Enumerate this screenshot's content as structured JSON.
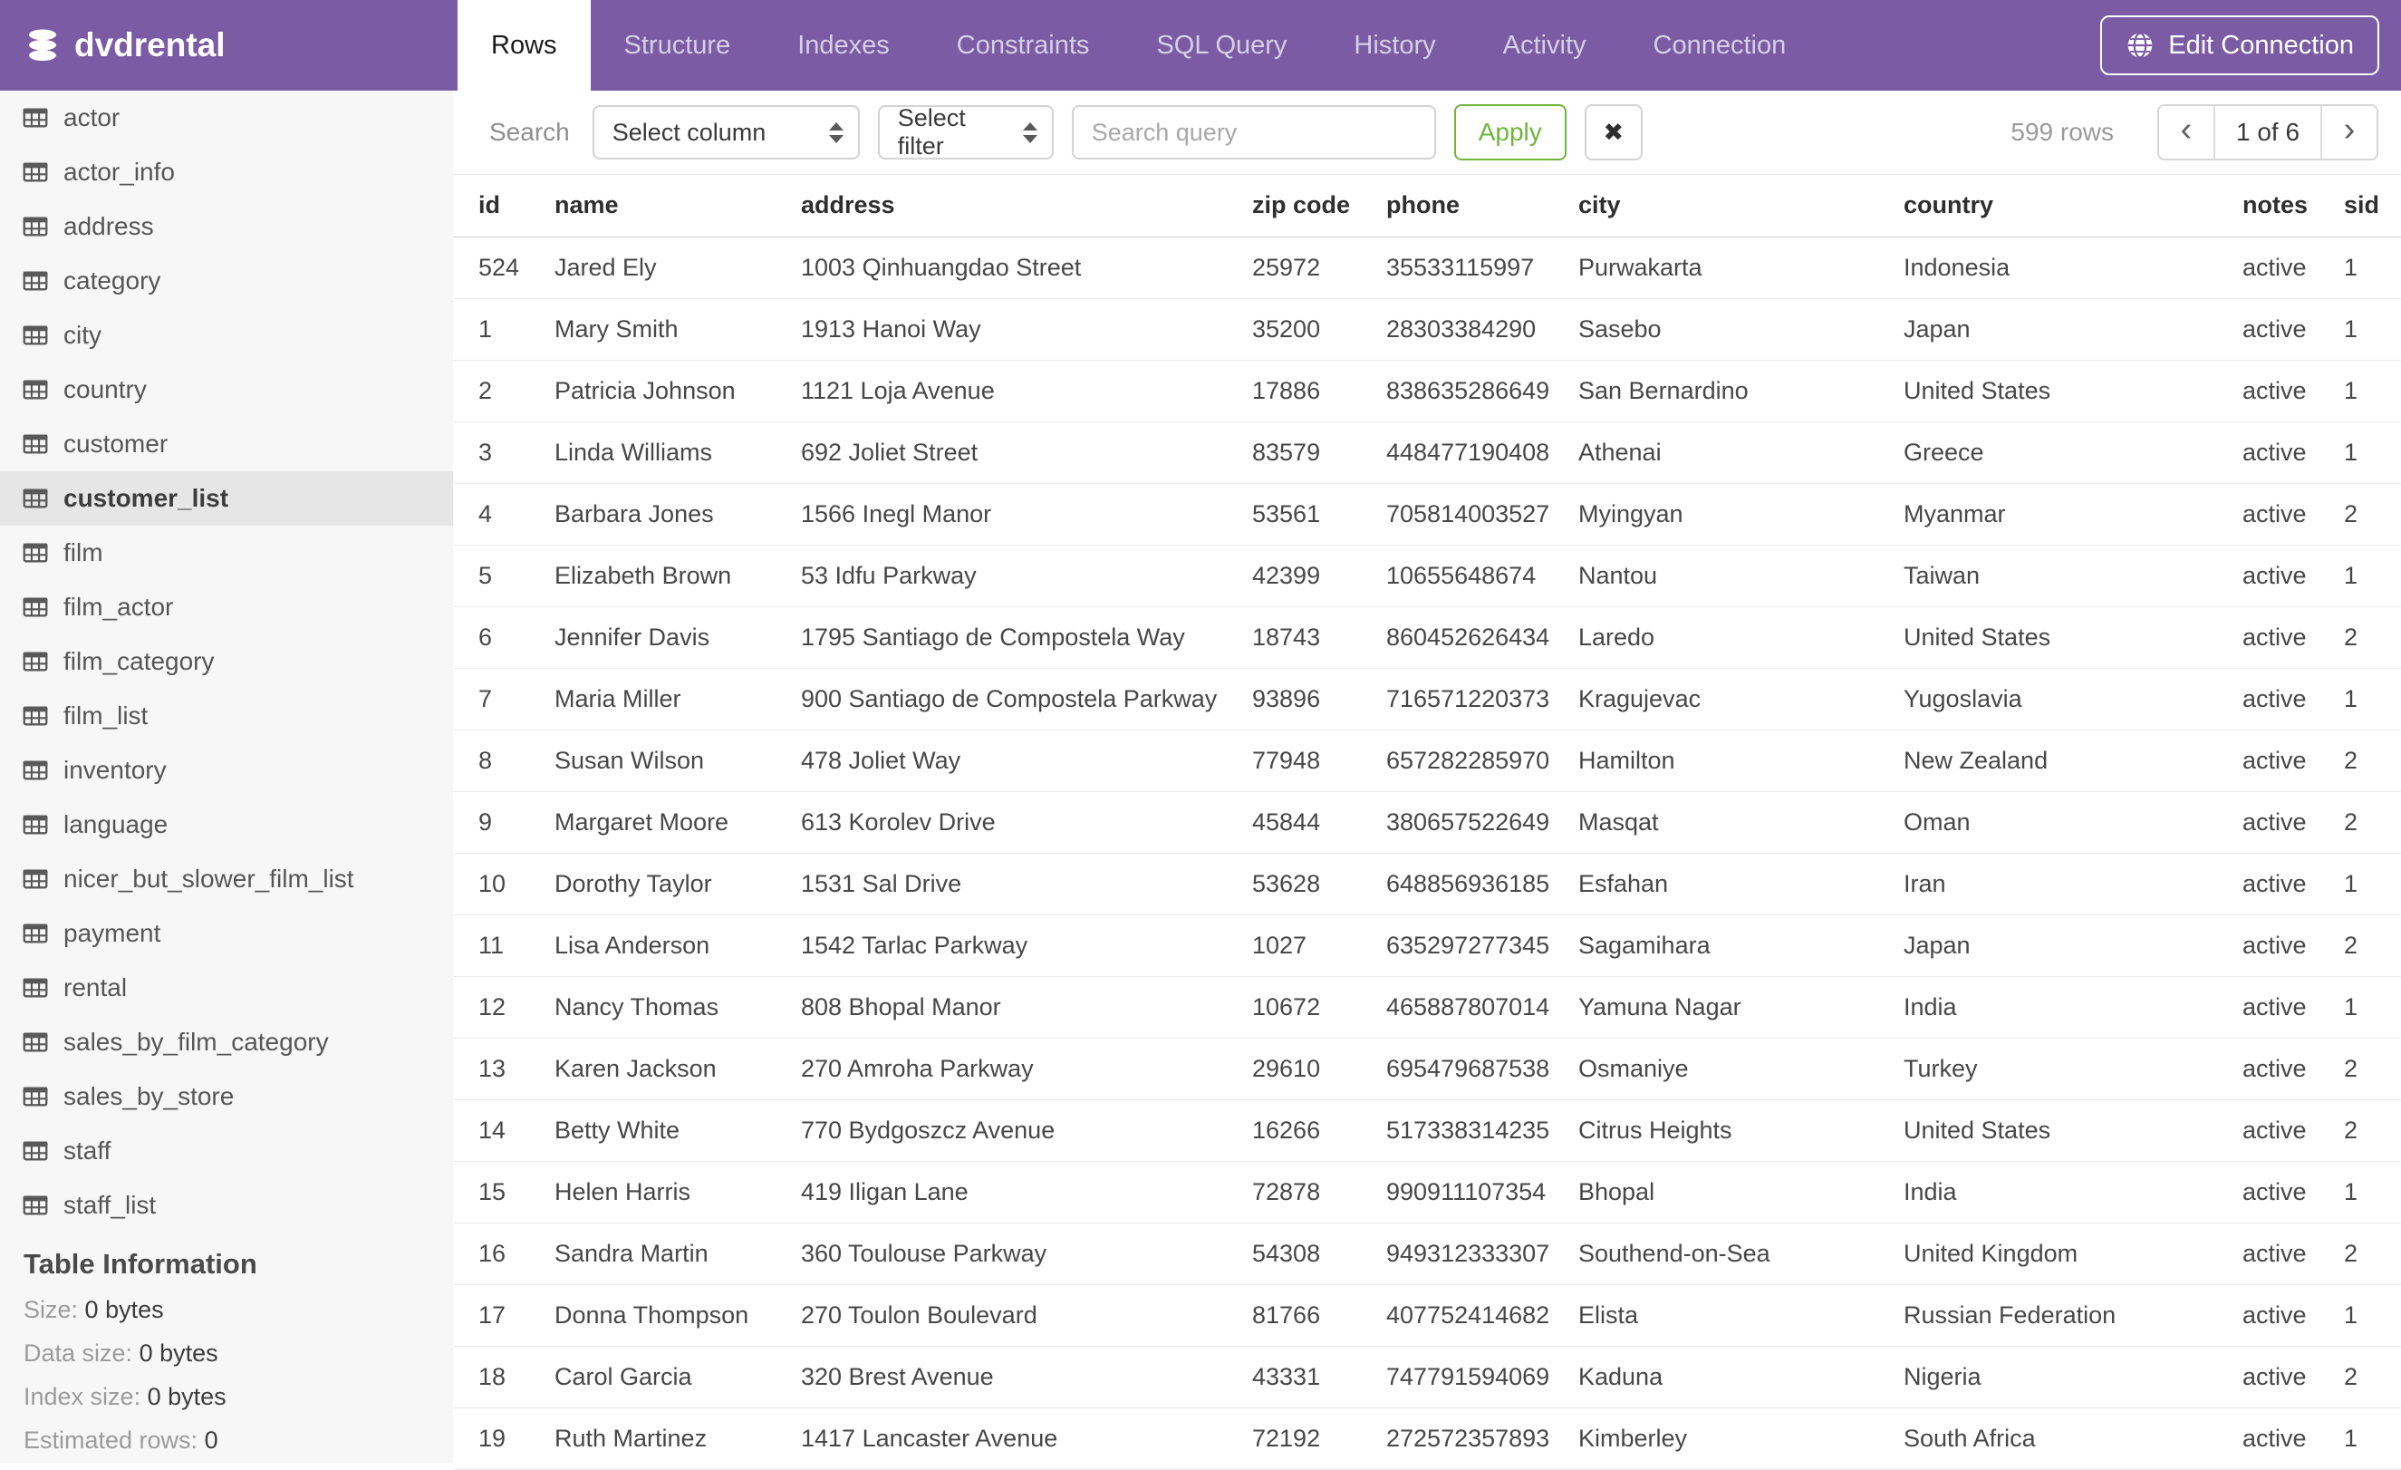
{
  "header": {
    "database_name": "dvdrental",
    "tabs": [
      {
        "label": "Rows",
        "active": true
      },
      {
        "label": "Structure",
        "active": false
      },
      {
        "label": "Indexes",
        "active": false
      },
      {
        "label": "Constraints",
        "active": false
      },
      {
        "label": "SQL Query",
        "active": false
      },
      {
        "label": "History",
        "active": false
      },
      {
        "label": "Activity",
        "active": false
      },
      {
        "label": "Connection",
        "active": false
      }
    ],
    "edit_connection_label": "Edit Connection"
  },
  "sidebar": {
    "tables": [
      "actor",
      "actor_info",
      "address",
      "category",
      "city",
      "country",
      "customer",
      "customer_list",
      "film",
      "film_actor",
      "film_category",
      "film_list",
      "inventory",
      "language",
      "nicer_but_slower_film_list",
      "payment",
      "rental",
      "sales_by_film_category",
      "sales_by_store",
      "staff",
      "staff_list"
    ],
    "selected_table": "customer_list",
    "info": {
      "heading": "Table Information",
      "rows": [
        {
          "label": "Size:",
          "value": "0 bytes"
        },
        {
          "label": "Data size:",
          "value": "0 bytes"
        },
        {
          "label": "Index size:",
          "value": "0 bytes"
        },
        {
          "label": "Estimated rows:",
          "value": "0"
        }
      ]
    }
  },
  "filter_bar": {
    "search_label": "Search",
    "column_select_value": "Select column",
    "filter_select_value": "Select filter",
    "query_placeholder": "Search query",
    "query_value": "",
    "apply_label": "Apply",
    "clear_icon": "✖",
    "rows_count": "599 rows",
    "pagination": {
      "prev": "‹",
      "current": "1 of 6",
      "next": "›"
    }
  },
  "table": {
    "columns": [
      "id",
      "name",
      "address",
      "zip code",
      "phone",
      "city",
      "country",
      "notes",
      "sid"
    ],
    "rows": [
      [
        "524",
        "Jared Ely",
        "1003 Qinhuangdao Street",
        "25972",
        "35533115997",
        "Purwakarta",
        "Indonesia",
        "active",
        "1"
      ],
      [
        "1",
        "Mary Smith",
        "1913 Hanoi Way",
        "35200",
        "28303384290",
        "Sasebo",
        "Japan",
        "active",
        "1"
      ],
      [
        "2",
        "Patricia Johnson",
        "1121 Loja Avenue",
        "17886",
        "838635286649",
        "San Bernardino",
        "United States",
        "active",
        "1"
      ],
      [
        "3",
        "Linda Williams",
        "692 Joliet Street",
        "83579",
        "448477190408",
        "Athenai",
        "Greece",
        "active",
        "1"
      ],
      [
        "4",
        "Barbara Jones",
        "1566 Inegl Manor",
        "53561",
        "705814003527",
        "Myingyan",
        "Myanmar",
        "active",
        "2"
      ],
      [
        "5",
        "Elizabeth Brown",
        "53 Idfu Parkway",
        "42399",
        "10655648674",
        "Nantou",
        "Taiwan",
        "active",
        "1"
      ],
      [
        "6",
        "Jennifer Davis",
        "1795 Santiago de Compostela Way",
        "18743",
        "860452626434",
        "Laredo",
        "United States",
        "active",
        "2"
      ],
      [
        "7",
        "Maria Miller",
        "900 Santiago de Compostela Parkway",
        "93896",
        "716571220373",
        "Kragujevac",
        "Yugoslavia",
        "active",
        "1"
      ],
      [
        "8",
        "Susan Wilson",
        "478 Joliet Way",
        "77948",
        "657282285970",
        "Hamilton",
        "New Zealand",
        "active",
        "2"
      ],
      [
        "9",
        "Margaret Moore",
        "613 Korolev Drive",
        "45844",
        "380657522649",
        "Masqat",
        "Oman",
        "active",
        "2"
      ],
      [
        "10",
        "Dorothy Taylor",
        "1531 Sal Drive",
        "53628",
        "648856936185",
        "Esfahan",
        "Iran",
        "active",
        "1"
      ],
      [
        "11",
        "Lisa Anderson",
        "1542 Tarlac Parkway",
        "1027",
        "635297277345",
        "Sagamihara",
        "Japan",
        "active",
        "2"
      ],
      [
        "12",
        "Nancy Thomas",
        "808 Bhopal Manor",
        "10672",
        "465887807014",
        "Yamuna Nagar",
        "India",
        "active",
        "1"
      ],
      [
        "13",
        "Karen Jackson",
        "270 Amroha Parkway",
        "29610",
        "695479687538",
        "Osmaniye",
        "Turkey",
        "active",
        "2"
      ],
      [
        "14",
        "Betty White",
        "770 Bydgoszcz Avenue",
        "16266",
        "517338314235",
        "Citrus Heights",
        "United States",
        "active",
        "2"
      ],
      [
        "15",
        "Helen Harris",
        "419 Iligan Lane",
        "72878",
        "990911107354",
        "Bhopal",
        "India",
        "active",
        "1"
      ],
      [
        "16",
        "Sandra Martin",
        "360 Toulouse Parkway",
        "54308",
        "949312333307",
        "Southend-on-Sea",
        "United Kingdom",
        "active",
        "2"
      ],
      [
        "17",
        "Donna Thompson",
        "270 Toulon Boulevard",
        "81766",
        "407752414682",
        "Elista",
        "Russian Federation",
        "active",
        "1"
      ],
      [
        "18",
        "Carol Garcia",
        "320 Brest Avenue",
        "43331",
        "747791594069",
        "Kaduna",
        "Nigeria",
        "active",
        "2"
      ],
      [
        "19",
        "Ruth Martinez",
        "1417 Lancaster Avenue",
        "72192",
        "272572357893",
        "Kimberley",
        "South Africa",
        "active",
        "1"
      ]
    ]
  },
  "colors": {
    "topbar_purple": "#7c5ba5",
    "tab_inactive_text": "#d7cfe4",
    "sidebar_bg": "#f7f7f7",
    "sidebar_selected_bg": "#e6e6e6",
    "apply_green": "#6fb53c",
    "muted_text": "#9a9a9a",
    "row_border": "#ececec"
  }
}
